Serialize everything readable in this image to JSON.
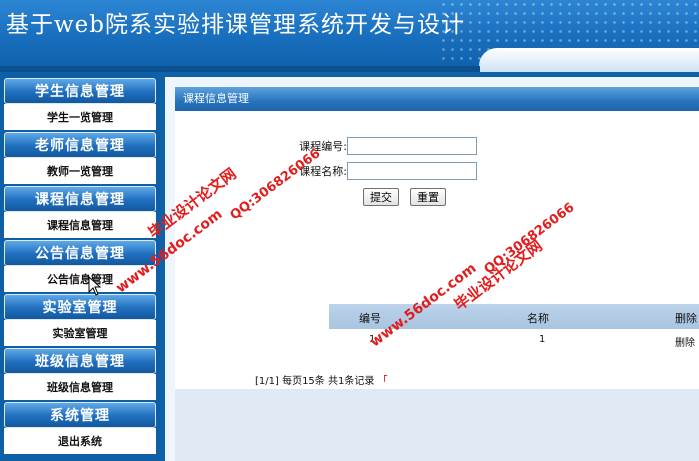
{
  "header": {
    "title": "基于web院系实验排课管理系统开发与设计"
  },
  "sidebar": {
    "groups": [
      {
        "title": "学生信息管理",
        "item": "学生一览管理"
      },
      {
        "title": "老师信息管理",
        "item": "教师一览管理"
      },
      {
        "title": "课程信息管理",
        "item": "课程信息管理"
      },
      {
        "title": "公告信息管理",
        "item": "公告信息管理"
      },
      {
        "title": "实验室管理",
        "item": "实验室管理"
      },
      {
        "title": "班级信息管理",
        "item": "班级信息管理"
      },
      {
        "title": "系统管理",
        "item": "退出系统"
      }
    ]
  },
  "main": {
    "panel_title": "课程信息管理",
    "form": {
      "code_label": "课程编号:",
      "code_value": "",
      "name_label": "课程名称:",
      "name_value": "",
      "submit_label": "提交",
      "reset_label": "重置"
    },
    "table": {
      "columns": [
        "编号",
        "名称",
        "删除"
      ],
      "rows": [
        {
          "id": "1",
          "name": "1",
          "action": "删除"
        }
      ]
    },
    "pager": {
      "text": "[1/1] 每页15条 共1条记录",
      "link": "「"
    }
  },
  "watermarks": {
    "site": "www.56doc.com",
    "qq": "QQ:306826066",
    "brand": "毕业设计论文网"
  },
  "colors": {
    "header_blue": "#1a71c0",
    "sidebar_blue": "#0e5fa6",
    "panel_title_blue": "#2673bd",
    "watermark_red": "#e21d1d"
  }
}
